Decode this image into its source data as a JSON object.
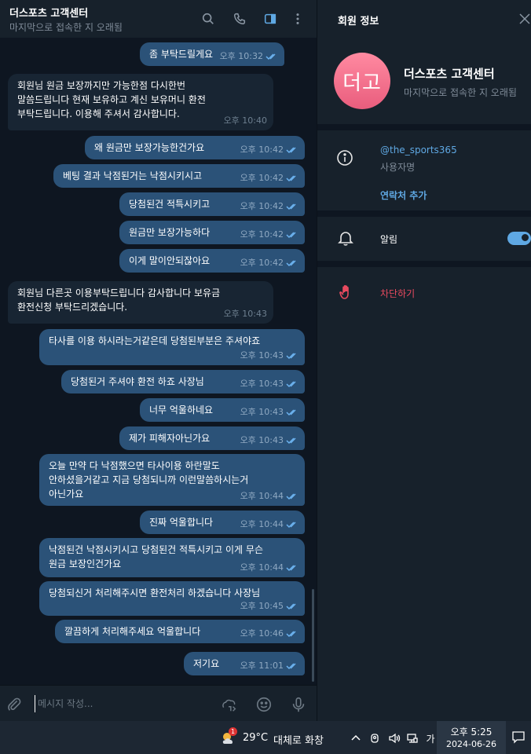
{
  "chat": {
    "title": "더스포츠 고객센터",
    "status": "마지막으로 접속한 지 오래됨",
    "input_placeholder": "메시지 작성...",
    "messages": [
      {
        "dir": "out",
        "text": "좀 부탁드릴게요",
        "time": "오후 10:32",
        "read": true
      },
      {
        "dir": "in",
        "text": "회원님 원금 보장까지만 가능한점 다시한번\n말씀드립니다 현재 보유하고 계신 보유머니 환전\n부탁드립니다. 이용해 주셔서 감사합니다.",
        "time": "오후 10:40"
      },
      {
        "dir": "out",
        "text": "왜 원금만 보장가능한건가요",
        "time": "오후 10:42",
        "read": true
      },
      {
        "dir": "out",
        "text": "베팅 결과 낙점된거는 낙점시키시고",
        "time": "오후 10:42",
        "read": true
      },
      {
        "dir": "out",
        "text": "당첨된건 적특시키고",
        "time": "오후 10:42",
        "read": true
      },
      {
        "dir": "out",
        "text": "원금만 보장가능하다",
        "time": "오후 10:42",
        "read": true
      },
      {
        "dir": "out",
        "text": "이게 말이안되잖아요",
        "time": "오후 10:42",
        "read": true
      },
      {
        "dir": "in",
        "text": "회원님 다른곳 이용부탁드립니다 감사합니다 보유금\n환전신청 부탁드리겠습니다.",
        "time": "오후 10:43"
      },
      {
        "dir": "out",
        "text": "타사를 이용 하시라는거같은데 당첨된부분은 주셔야죠",
        "time": "오후 10:43",
        "read": true
      },
      {
        "dir": "out",
        "text": "당첨된거 주셔야 환전 하죠 사장님",
        "time": "오후 10:43",
        "read": true
      },
      {
        "dir": "out",
        "text": "너무 억울하네요",
        "time": "오후 10:43",
        "read": true
      },
      {
        "dir": "out",
        "text": "제가 피해자아닌가요",
        "time": "오후 10:43",
        "read": true
      },
      {
        "dir": "out",
        "text": "오늘 만약 다 낙점했으면 타사이용 하란말도\n안하셨을거같고 지금 당첨되니까 이런말씀하시는거\n아닌가요",
        "time": "오후 10:44",
        "read": true
      },
      {
        "dir": "out",
        "text": "진짜 억울합니다",
        "time": "오후 10:44",
        "read": true
      },
      {
        "dir": "out",
        "text": "낙점된건 낙점시키시고 당첨된건 적특시키고 이게 무슨\n원금 보장인건가요",
        "time": "오후 10:44",
        "read": true
      },
      {
        "dir": "out",
        "text": "당첨되신거 처리해주시면 환전처리 하겠습니다 사장님",
        "time": "오후 10:45",
        "read": true
      },
      {
        "dir": "out",
        "text": "깔끔하게 처리해주세요 억울합니다",
        "time": "오후 10:46",
        "read": true
      },
      {
        "dir": "out",
        "text": "저기요",
        "time": "오후 11:01",
        "read": true
      }
    ]
  },
  "info": {
    "title": "회원 정보",
    "avatar_text": "더고",
    "name": "더스포츠 고객센터",
    "status": "마지막으로 접속한 지 오래됨",
    "username": "@the_sports365",
    "username_label": "사용자명",
    "add_contact": "연락처 추가",
    "notifications_label": "알림",
    "notifications_on": true,
    "block_label": "차단하기"
  },
  "taskbar": {
    "weather_badge": "1",
    "temperature": "29°C",
    "weather": "대체로 화창",
    "ime": "가",
    "time": "오후 5:25",
    "date": "2024-06-26"
  },
  "colors": {
    "outgoing_bubble": "#2b5278",
    "incoming_bubble": "#182533",
    "link": "#5fa8e3",
    "danger": "#e84a5f",
    "avatar": "#ee6f8c"
  }
}
